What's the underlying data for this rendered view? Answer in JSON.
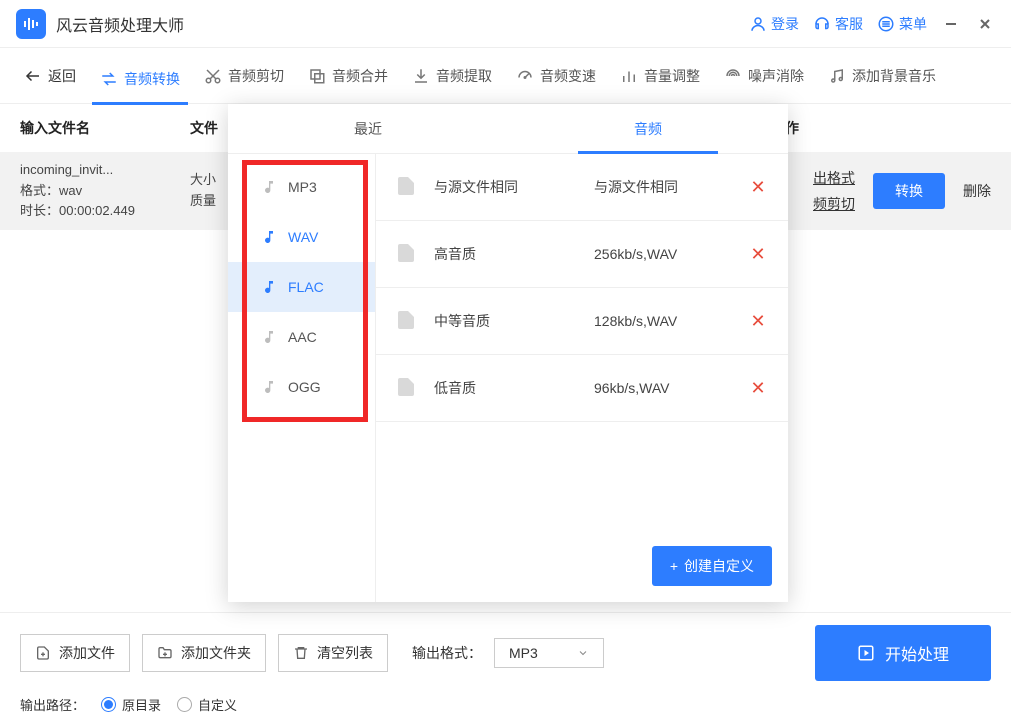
{
  "app": {
    "title": "风云音频处理大师"
  },
  "title_actions": {
    "login": "登录",
    "support": "客服",
    "menu": "菜单"
  },
  "toolbar": {
    "back": "返回",
    "convert": "音频转换",
    "trim": "音频剪切",
    "merge": "音频合并",
    "extract": "音频提取",
    "speed": "音频变速",
    "volume": "音量调整",
    "noise": "噪声消除",
    "bgm": "添加背景音乐"
  },
  "headers": {
    "file": "输入文件名",
    "info": "文件",
    "op": "操作"
  },
  "file": {
    "name": "incoming_invit...",
    "format_label": "格式：",
    "format_value": "wav",
    "duration_label": "时长：",
    "duration_value": "00:00:02.449",
    "info_size": "大小",
    "info_quality": "质量",
    "op_output_format": "出格式",
    "op_trim": "频剪切",
    "convert_btn": "转换",
    "delete": "删除"
  },
  "bottom": {
    "add_file": "添加文件",
    "add_folder": "添加文件夹",
    "clear_list": "清空列表",
    "output_format_label": "输出格式：",
    "output_format_value": "MP3",
    "start": "开始处理",
    "output_path_label": "输出路径：",
    "radio_original": "原目录",
    "radio_custom": "自定义"
  },
  "popover": {
    "tab_recent": "最近",
    "tab_audio": "音频",
    "formats": [
      "MP3",
      "WAV",
      "FLAC",
      "AAC",
      "OGG"
    ],
    "qualities": [
      {
        "name": "与源文件相同",
        "spec": "与源文件相同"
      },
      {
        "name": "高音质",
        "spec": "256kb/s,WAV"
      },
      {
        "name": "中等音质",
        "spec": "128kb/s,WAV"
      },
      {
        "name": "低音质",
        "spec": "96kb/s,WAV"
      }
    ],
    "custom_btn": "创建自定义"
  }
}
